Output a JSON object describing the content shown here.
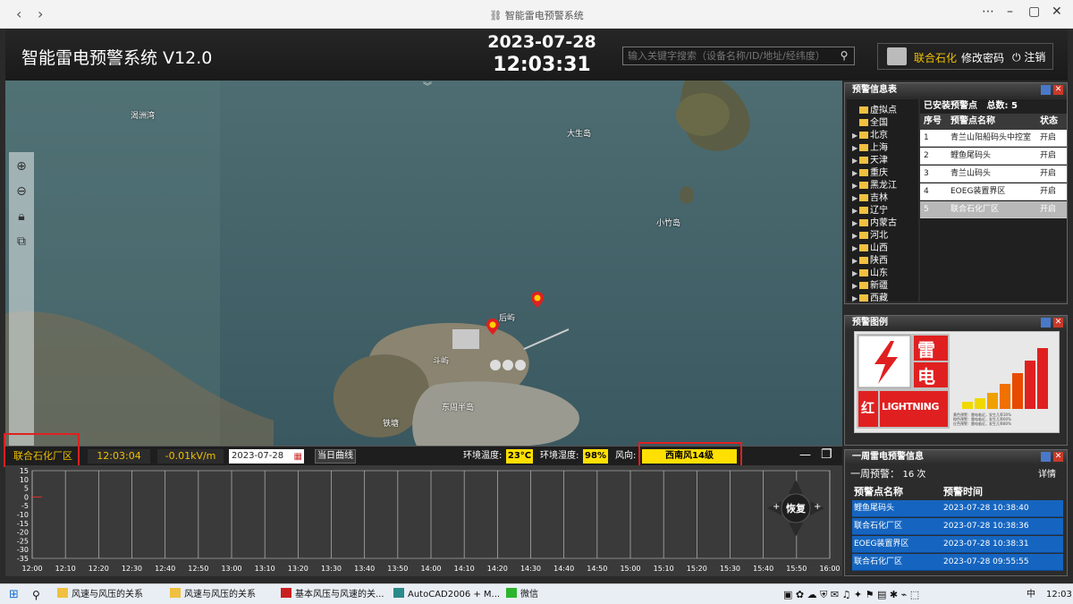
{
  "browser": {
    "title": "智能雷电预警系统"
  },
  "header": {
    "app_title": "智能雷电预警系统 V12.0",
    "date": "2023-07-28",
    "time": "12:03:31",
    "search_placeholder": "输入关键字搜索（设备名称/ID/地址/经纬度）",
    "user_name": "联合石化",
    "change_password": "修改密码",
    "logout": "注销"
  },
  "map": {
    "labels": [
      "渴洲湾",
      "大生岛",
      "小竹岛",
      "后屿",
      "斗屿",
      "东周半岛",
      "铁塘"
    ]
  },
  "status_bar": {
    "site": "联合石化厂区",
    "time": "12:03:04",
    "field": "-0.01kV/m",
    "date_value": "2023-07-28",
    "today_curve": "当日曲线",
    "temp_label": "环境温度:",
    "temp_value": "23°C",
    "humidity_label": "环境湿度:",
    "humidity_value": "98%",
    "wind_label": "风向:",
    "wind_value": "西南风14级"
  },
  "chart_data": {
    "type": "line",
    "y_ticks": [
      "15",
      "10",
      "5",
      "0",
      "-5",
      "-10",
      "-15",
      "-20",
      "-25",
      "-30",
      "-35"
    ],
    "x_ticks": [
      "12:00",
      "12:10",
      "12:20",
      "12:30",
      "12:40",
      "12:50",
      "13:00",
      "13:10",
      "13:20",
      "13:30",
      "13:40",
      "13:50",
      "14:00",
      "14:10",
      "14:20",
      "14:30",
      "14:40",
      "14:50",
      "15:00",
      "15:10",
      "15:20",
      "15:30",
      "15:40",
      "15:50",
      "16:00"
    ],
    "ylim": [
      -35,
      15
    ],
    "series": [
      {
        "x": [
          "12:00",
          "12:03"
        ],
        "values": [
          0,
          0
        ],
        "color": "#e03030"
      }
    ],
    "control_label": "恢复"
  },
  "info_panel": {
    "title": "预警信息表",
    "tree": [
      {
        "label": "虚拟点",
        "arrow": false
      },
      {
        "label": "全国",
        "arrow": false
      },
      {
        "label": "北京",
        "arrow": true
      },
      {
        "label": "上海",
        "arrow": true
      },
      {
        "label": "天津",
        "arrow": true
      },
      {
        "label": "重庆",
        "arrow": true
      },
      {
        "label": "黑龙江",
        "arrow": true
      },
      {
        "label": "吉林",
        "arrow": true
      },
      {
        "label": "辽宁",
        "arrow": true
      },
      {
        "label": "内蒙古",
        "arrow": true
      },
      {
        "label": "河北",
        "arrow": true
      },
      {
        "label": "山西",
        "arrow": true
      },
      {
        "label": "陕西",
        "arrow": true
      },
      {
        "label": "山东",
        "arrow": true
      },
      {
        "label": "新疆",
        "arrow": true
      },
      {
        "label": "西藏",
        "arrow": true
      }
    ],
    "installed_label": "已安装预警点",
    "total_label": "总数:",
    "total": "5",
    "columns": [
      "序号",
      "预警点名称",
      "状态"
    ],
    "rows": [
      {
        "no": "1",
        "name": "青兰山阳船码头中控室",
        "status": "开启"
      },
      {
        "no": "2",
        "name": "鲤鱼尾码头",
        "status": "开启"
      },
      {
        "no": "3",
        "name": "青兰山码头",
        "status": "开启"
      },
      {
        "no": "4",
        "name": "EOEG装置界区",
        "status": "开启"
      },
      {
        "no": "5",
        "name": "联合石化厂区",
        "status": "开启"
      }
    ]
  },
  "legend_panel": {
    "title": "预警图例",
    "char1": "雷",
    "char2": "电",
    "red_char": "红",
    "lightning_text": "LIGHTNING",
    "notes": [
      "黄色预警：雷电临近，发生几率30%",
      "橙色预警：雷电临近，发生几率60%",
      "红色预警：雷电临近，发生几率80%"
    ]
  },
  "week_panel": {
    "title": "一周雷电预警信息",
    "summary_label": "一周预警：",
    "summary_value": "16 次",
    "detail": "详情",
    "columns": [
      "预警点名称",
      "预警时间"
    ],
    "rows": [
      {
        "name": "鲤鱼尾码头",
        "time": "2023-07-28 10:38:40"
      },
      {
        "name": "联合石化厂区",
        "time": "2023-07-28 10:38:36"
      },
      {
        "name": "EOEG装置界区",
        "time": "2023-07-28 10:38:31"
      },
      {
        "name": "联合石化厂区",
        "time": "2023-07-28 09:55:55"
      }
    ]
  },
  "taskbar": {
    "items": [
      "风速与风压的关系",
      "风速与风压的关系",
      "基本风压与风速的关...",
      "AutoCAD2006 + M...",
      "微信"
    ],
    "lang": "中",
    "clock": "12:03"
  },
  "colors": {
    "accent": "#f0c000",
    "highlight_red": "#e02020",
    "week_row": "#1565c0"
  }
}
